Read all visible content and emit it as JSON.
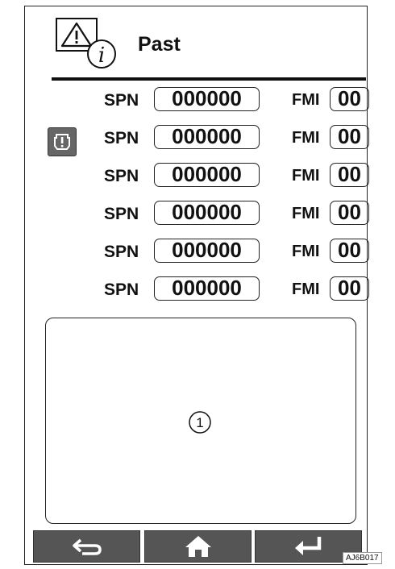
{
  "header": {
    "title": "Past",
    "warning_icon": "warning-triangle-icon",
    "info_icon": "info-circle-icon"
  },
  "codes": [
    {
      "spn_label": "SPN",
      "spn_value": "000000",
      "fmi_label": "FMI",
      "fmi_value": "00"
    },
    {
      "spn_label": "SPN",
      "spn_value": "000000",
      "fmi_label": "FMI",
      "fmi_value": "00"
    },
    {
      "spn_label": "SPN",
      "spn_value": "000000",
      "fmi_label": "FMI",
      "fmi_value": "00"
    },
    {
      "spn_label": "SPN",
      "spn_value": "000000",
      "fmi_label": "FMI",
      "fmi_value": "00"
    },
    {
      "spn_label": "SPN",
      "spn_value": "000000",
      "fmi_label": "FMI",
      "fmi_value": "00"
    },
    {
      "spn_label": "SPN",
      "spn_value": "000000",
      "fmi_label": "FMI",
      "fmi_value": "00"
    }
  ],
  "side_button": {
    "icon": "engine-alert-icon"
  },
  "detail_panel": {
    "callout": "1"
  },
  "nav": {
    "back_icon": "back-arrow-icon",
    "home_icon": "home-icon",
    "enter_icon": "enter-arrow-icon"
  },
  "figure_code": "AJ6B017"
}
